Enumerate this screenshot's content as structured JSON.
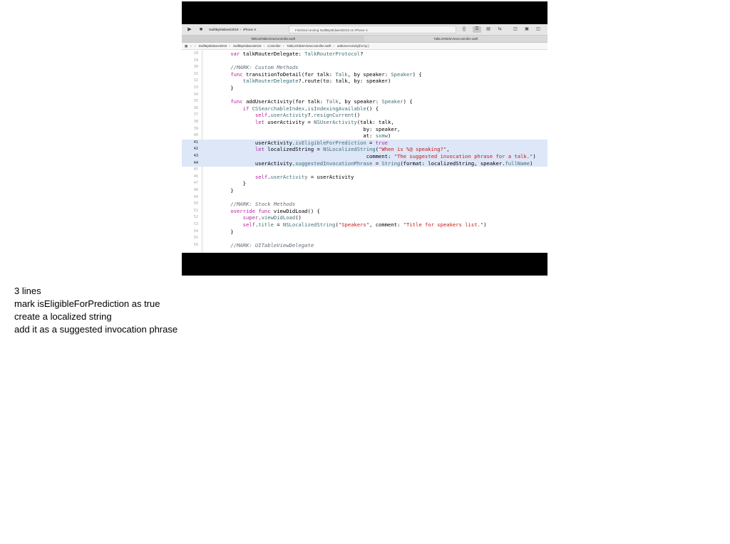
{
  "toolbar": {
    "run_icon": "play-icon",
    "stop_icon": "stop-icon",
    "scheme_project": "SwiftByMidwest2019",
    "scheme_device": "iPhone X",
    "status": "Finished running SwiftByMidwest2019 on iPhone X"
  },
  "tabs": [
    "TalkListTableViewController.swift",
    "TalkListTableViewController.swift"
  ],
  "jumpbar": {
    "items": [
      "SwiftByMidwest2019",
      "SwiftByMidwest2019",
      "Controller",
      "TalkListTableViewController.swift",
      "addUserActivity(for:by:)"
    ]
  },
  "code_lines": [
    {
      "n": "28",
      "hl": false,
      "html": "    <span class=\"k\">var</span> talkRouterDelegate: <span class=\"t\">TalkRouterProtocol</span>?"
    },
    {
      "n": "29",
      "hl": false,
      "html": ""
    },
    {
      "n": "30",
      "hl": false,
      "html": "    <span class=\"c\">//MARK: Custom Methods</span>"
    },
    {
      "n": "31",
      "hl": false,
      "html": "    <span class=\"k\">func</span> transitionToDetail(for talk: <span class=\"t\">Talk</span>, by speaker: <span class=\"t\">Speaker</span>) {"
    },
    {
      "n": "32",
      "hl": false,
      "html": "        <span class=\"m\">talkRouterDelegate</span>?.route(to: talk, by: speaker)"
    },
    {
      "n": "33",
      "hl": false,
      "html": "    }"
    },
    {
      "n": "34",
      "hl": false,
      "html": ""
    },
    {
      "n": "35",
      "hl": false,
      "html": "    <span class=\"k\">func</span> addUserActivity(for talk: <span class=\"t\">Talk</span>, by speaker: <span class=\"t\">Speaker</span>) {"
    },
    {
      "n": "36",
      "hl": false,
      "html": "        <span class=\"k\">if</span> <span class=\"t\">CSSearchableIndex</span>.<span class=\"t\">isIndexingAvailable</span>() {"
    },
    {
      "n": "37",
      "hl": false,
      "html": "            <span class=\"k\">self</span>.<span class=\"t\">userActivity</span>?.<span class=\"t\">resignCurrent</span>()"
    },
    {
      "n": "38",
      "hl": false,
      "html": "            <span class=\"k\">let</span> userActivity = <span class=\"t\">NSUserActivity</span>(talk: talk,"
    },
    {
      "n": "39",
      "hl": false,
      "html": "                                               by: speaker,"
    },
    {
      "n": "40",
      "hl": false,
      "html": "                                               at: <span class=\"t\">sxmw</span>)"
    },
    {
      "n": "41",
      "hl": true,
      "html": "            userActivity.<span class=\"t\">isEligibleForPrediction</span> = <span class=\"k\">true</span>"
    },
    {
      "n": "42",
      "hl": true,
      "html": "            <span class=\"k\">let</span> localizedString = <span class=\"t\">NSLocalizedString</span>(<span class=\"s\">\"When is %@ speaking?\"</span>,"
    },
    {
      "n": "43",
      "hl": true,
      "html": "                                                comment: <span class=\"s\">\"The suggested invocation phrase for a talk.\"</span>)"
    },
    {
      "n": "44",
      "hl": true,
      "html": "            userActivity.<span class=\"t\">suggestedInvocationPhrase</span> = <span class=\"t\">String</span>(format: localizedString, speaker.<span class=\"t\">fullName</span>)"
    },
    {
      "n": "45",
      "hl": false,
      "html": ""
    },
    {
      "n": "46",
      "hl": false,
      "html": "            <span class=\"k\">self</span>.<span class=\"t\">userActivity</span> = userActivity"
    },
    {
      "n": "47",
      "hl": false,
      "html": "        }"
    },
    {
      "n": "48",
      "hl": false,
      "html": "    }"
    },
    {
      "n": "49",
      "hl": false,
      "html": ""
    },
    {
      "n": "50",
      "hl": false,
      "html": "    <span class=\"c\">//MARK: Stock Methods</span>"
    },
    {
      "n": "51",
      "hl": false,
      "html": "    <span class=\"k\">override func</span> viewDidLoad() {"
    },
    {
      "n": "52",
      "hl": false,
      "html": "        <span class=\"k\">super</span>.<span class=\"t\">viewDidLoad</span>()"
    },
    {
      "n": "53",
      "hl": false,
      "html": "        <span class=\"k\">self</span>.<span class=\"t\">title</span> = <span class=\"t\">NSLocalizedString</span>(<span class=\"s\">\"Speakers\"</span>, comment: <span class=\"s\">\"Title for speakers list.\"</span>)"
    },
    {
      "n": "54",
      "hl": false,
      "html": "    }"
    },
    {
      "n": "55",
      "hl": false,
      "html": ""
    },
    {
      "n": "56",
      "hl": false,
      "html": "    <span class=\"c\">//MARK: UITableViewDelegate</span>"
    }
  ],
  "notes": [
    "3 lines",
    "mark isEligibleForPrediction as true",
    "create a localized string",
    "add it as a suggested invocation phrase"
  ]
}
